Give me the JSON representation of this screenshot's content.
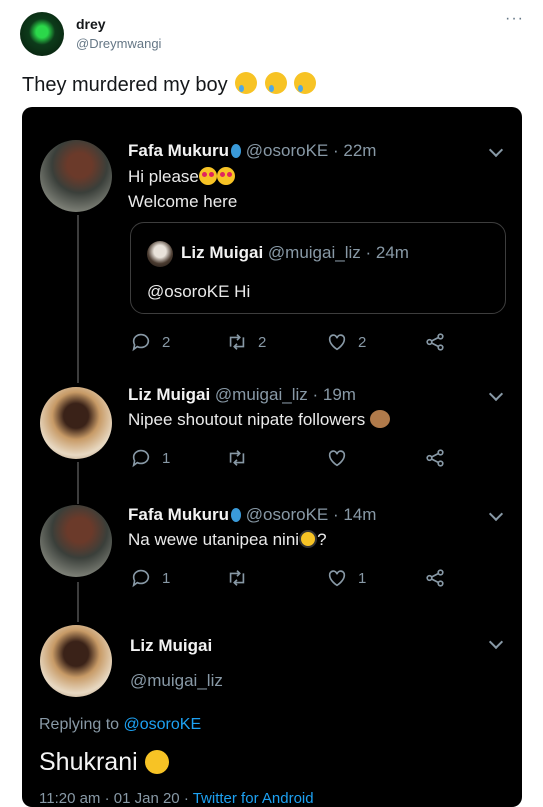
{
  "outer_tweet": {
    "name": "drey",
    "handle": "@Dreymwangi",
    "text": "They murdered my boy",
    "more_icon": "more-dots-icon"
  },
  "screenshot": {
    "tweet1": {
      "name": "Fafa Mukuru",
      "handle_time": "@osoroKE · 22m",
      "line1": "Hi please",
      "line2": "Welcome here",
      "quote": {
        "name": "Liz Muigai",
        "handle_time": "@muigai_liz · 24m",
        "text": "@osoroKE Hi"
      },
      "replies": "2",
      "retweets": "2",
      "likes": "2"
    },
    "tweet2": {
      "name": "Liz Muigai",
      "handle_time": "@muigai_liz · 19m",
      "text": "Nipee shoutout nipate followers",
      "replies": "1"
    },
    "tweet3": {
      "name": "Fafa Mukuru",
      "handle_time": "@osoroKE · 14m",
      "text": "Na wewe utanipea nini",
      "text_suffix": "?",
      "replies": "1",
      "likes": "1"
    },
    "focused": {
      "name": "Liz Muigai",
      "handle": "@muigai_liz",
      "replying_to_label": "Replying to ",
      "replying_to_handle": "@osoroKE",
      "text": "Shukrani",
      "meta_time": "11:20 am · 01 Jan 20 · ",
      "meta_source": "Twitter for Android"
    }
  },
  "colors": {
    "dark_bg": "#000000",
    "link_blue": "#1da1f2",
    "muted": "#8899a6"
  }
}
